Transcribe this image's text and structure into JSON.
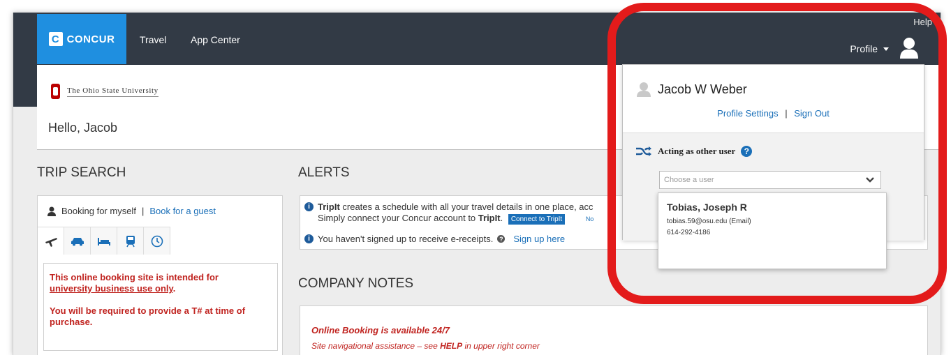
{
  "topnav": {
    "logo_text": "CONCUR",
    "logo_mark": "C",
    "links": [
      "Travel",
      "App Center"
    ],
    "help": "Help",
    "profile": "Profile"
  },
  "header": {
    "university": "The Ohio State University",
    "greeting": "Hello, Jacob"
  },
  "trip_search": {
    "title": "TRIP SEARCH",
    "booking_for_myself": "Booking for myself",
    "separator": "|",
    "book_for_guest": "Book for a guest",
    "tabs": [
      "flight-icon",
      "car-icon",
      "hotel-icon",
      "train-icon",
      "clock-icon"
    ],
    "notice_line1": "This online booking site is intended for",
    "notice_line2": "university business use only",
    "notice_line2_suffix": ".",
    "notice_line3": "You will be required to provide a T# at time of purchase."
  },
  "alerts": {
    "title": "ALERTS",
    "tripit_bold": "TripIt",
    "tripit_text": " creates a schedule with all your travel details in one place, acc",
    "tripit_line2_pre": "Simply connect your Concur account to ",
    "tripit_line2_bold": "TripIt",
    "tripit_line2_post": ".",
    "tripit_button": "Connect to TripIt",
    "tripit_no": "No",
    "ereceipt_text": "You haven't signed up to receive e-receipts.",
    "ereceipt_link": "Sign up here"
  },
  "company_notes": {
    "title": "COMPANY NOTES",
    "line1": "Online Booking is available 24/7",
    "line2_pre": "Site navigational assistance  – see ",
    "line2_bold": "HELP",
    "line2_post": " in upper right corner"
  },
  "profile_menu": {
    "user_name": "Jacob W Weber",
    "profile_settings": "Profile Settings",
    "separator": "|",
    "sign_out": "Sign Out",
    "acting_label": "Acting as other user",
    "select_placeholder": "Choose a user",
    "result": {
      "name": "Tobias, Joseph R",
      "email": "tobias.59@osu.edu (Email)",
      "phone": "614-292-4186"
    }
  },
  "colors": {
    "nav_bg": "#323a45",
    "brand_blue": "#1f8fe0",
    "link_blue": "#1a6fb8",
    "alert_red": "#c0231f",
    "highlight_red": "#e31b1b",
    "osu_red": "#bb0000"
  }
}
